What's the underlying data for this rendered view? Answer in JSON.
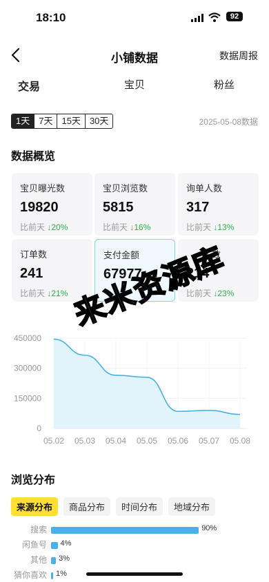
{
  "status": {
    "time": "18:10",
    "battery": "92"
  },
  "nav": {
    "title": "小铺数据",
    "right_link": "数据周报"
  },
  "tabs": [
    "交易",
    "宝贝",
    "粉丝"
  ],
  "range": {
    "options": [
      "1天",
      "7天",
      "15天",
      "30天"
    ],
    "selected": "1天",
    "date_note": "2025-05-08数据"
  },
  "overview": {
    "title": "数据概览",
    "cards": [
      {
        "label": "宝贝曝光数",
        "value": "19820",
        "cmp_prefix": "比前天",
        "cmp_value": "↓20%"
      },
      {
        "label": "宝贝浏览数",
        "value": "5815",
        "cmp_prefix": "比前天",
        "cmp_value": "↓16%"
      },
      {
        "label": "询单人数",
        "value": "317",
        "cmp_prefix": "比前天",
        "cmp_value": "↓13%"
      },
      {
        "label": "订单数",
        "value": "241",
        "cmp_prefix": "比前天",
        "cmp_value": "↓21%"
      },
      {
        "label": "支付金额",
        "value": "67977",
        "cmp_prefix": "",
        "cmp_value": ""
      },
      {
        "label": "人数",
        "value": "214",
        "cmp_prefix": "比前天",
        "cmp_value": "↓23%"
      }
    ]
  },
  "chart_data": {
    "type": "area",
    "x": [
      "05.02",
      "05.03",
      "05.04",
      "05.05",
      "05.06",
      "05.07",
      "05.08"
    ],
    "y_ticks": [
      "450000",
      "300000",
      "150000",
      "0"
    ],
    "ylim": [
      0,
      450000
    ],
    "values": [
      445000,
      365000,
      265000,
      255000,
      85000,
      90000,
      70000
    ],
    "grid": true
  },
  "distribution": {
    "title": "浏览分布",
    "tabs": [
      "来源分布",
      "商品分布",
      "时间分布",
      "地域分布"
    ],
    "selected": "来源分布",
    "rows": [
      {
        "label": "搜索",
        "value": "90%",
        "pct": 90
      },
      {
        "label": "闲鱼号",
        "value": "4%",
        "pct": 4
      },
      {
        "label": "其他",
        "value": "3%",
        "pct": 3
      },
      {
        "label": "猜你喜欢",
        "value": "1%",
        "pct": 1
      }
    ]
  },
  "watermark": "来米资源库",
  "colors": {
    "accent": "#ffe033",
    "chart_line": "#48b1e8",
    "down": "#2db24a"
  }
}
